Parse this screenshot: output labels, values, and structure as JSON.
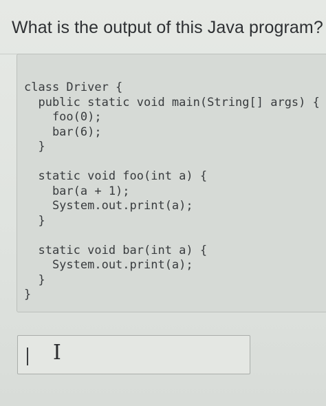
{
  "question": {
    "title": "What is the output of this Java program?"
  },
  "code": {
    "lines": [
      "class Driver {",
      "  public static void main(String[] args) {",
      "    foo(0);",
      "    bar(6);",
      "  }",
      "",
      "  static void foo(int a) {",
      "    bar(a + 1);",
      "    System.out.print(a);",
      "  }",
      "",
      "  static void bar(int a) {",
      "    System.out.print(a);",
      "  }",
      "}"
    ]
  },
  "answer": {
    "value": "",
    "placeholder": "",
    "cursor_icon": "text-cursor-ibeam-icon"
  },
  "colors": {
    "background": "#e1e4e0",
    "code_background": "#d6dad6",
    "text": "#2e3033"
  }
}
